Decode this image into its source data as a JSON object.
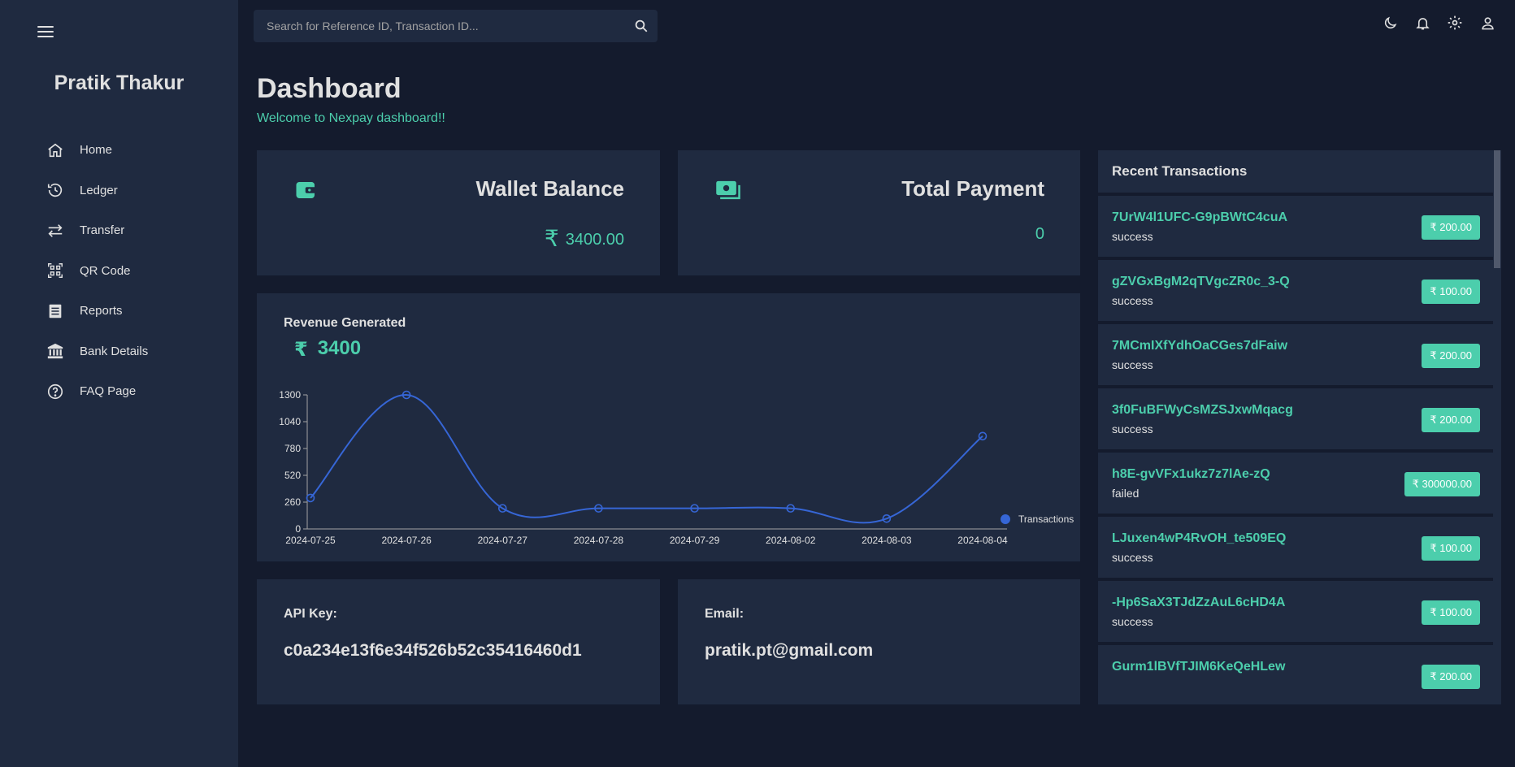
{
  "sidebar": {
    "user_name": "Pratik Thakur",
    "items": [
      {
        "label": "Home",
        "icon": "home-icon"
      },
      {
        "label": "Ledger",
        "icon": "history-icon"
      },
      {
        "label": "Transfer",
        "icon": "transfer-icon"
      },
      {
        "label": "QR Code",
        "icon": "qr-code-icon"
      },
      {
        "label": "Reports",
        "icon": "reports-icon"
      },
      {
        "label": "Bank Details",
        "icon": "bank-icon"
      },
      {
        "label": "FAQ Page",
        "icon": "help-icon"
      }
    ]
  },
  "topbar": {
    "search_placeholder": "Search for Reference ID, Transaction ID...",
    "icons": [
      "dark-mode-icon",
      "notifications-icon",
      "settings-icon",
      "profile-icon"
    ]
  },
  "header": {
    "title": "Dashboard",
    "subtitle": "Welcome to Nexpay dashboard!!"
  },
  "wallet": {
    "title": "Wallet Balance",
    "currency": "₹",
    "value": "3400.00"
  },
  "payment": {
    "title": "Total Payment",
    "value": "0"
  },
  "revenue": {
    "title": "Revenue Generated",
    "currency": "₹",
    "value": "3400"
  },
  "chart_data": {
    "type": "line",
    "x": [
      "2024-07-25",
      "2024-07-26",
      "2024-07-27",
      "2024-07-28",
      "2024-07-29",
      "2024-08-02",
      "2024-08-03",
      "2024-08-04"
    ],
    "series": [
      {
        "name": "Transactions",
        "values": [
          300,
          1300,
          200,
          200,
          200,
          200,
          100,
          900
        ],
        "color": "#3666d6"
      }
    ],
    "yticks": [
      0,
      260,
      520,
      780,
      1040,
      1300
    ],
    "ylim": [
      0,
      1300
    ],
    "legend": "right"
  },
  "api": {
    "label": "API Key:",
    "value": "c0a234e13f6e34f526b52c35416460d1"
  },
  "email": {
    "label": "Email:",
    "value": "pratik.pt@gmail.com"
  },
  "recent": {
    "title": "Recent Transactions",
    "transactions": [
      {
        "id": "7UrW4l1UFC-G9pBWtC4cuA",
        "status": "success",
        "amount": "₹ 200.00"
      },
      {
        "id": "gZVGxBgM2qTVgcZR0c_3-Q",
        "status": "success",
        "amount": "₹ 100.00"
      },
      {
        "id": "7MCmIXfYdhOaCGes7dFaiw",
        "status": "success",
        "amount": "₹ 200.00"
      },
      {
        "id": "3f0FuBFWyCsMZSJxwMqacg",
        "status": "success",
        "amount": "₹ 200.00"
      },
      {
        "id": "h8E-gvVFx1ukz7z7lAe-zQ",
        "status": "failed",
        "amount": "₹ 300000.00"
      },
      {
        "id": "LJuxen4wP4RvOH_te509EQ",
        "status": "success",
        "amount": "₹ 100.00"
      },
      {
        "id": "-Hp6SaX3TJdZzAuL6cHD4A",
        "status": "success",
        "amount": "₹ 100.00"
      },
      {
        "id": "Gurm1lBVfTJIM6KeQeHLew",
        "status": "",
        "amount": "₹ 200.00"
      }
    ]
  },
  "colors": {
    "background": "#141b2d",
    "panel": "#1f2a40",
    "accent": "#4cceac",
    "line": "#3666d6",
    "text": "#e0e0e0"
  }
}
